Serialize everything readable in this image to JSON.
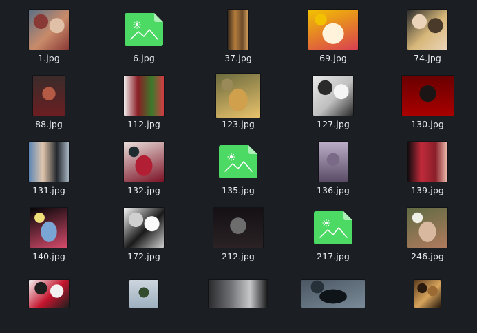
{
  "files": [
    {
      "name": "1.jpg",
      "kind": "photo",
      "selected": true,
      "colors": [
        "#5a6f86",
        "#c98b6a",
        "#8a3a36",
        "#e0c1a8"
      ]
    },
    {
      "name": "6.jpg",
      "kind": "image-icon",
      "colors": [
        "#4cd964",
        "#3fbf55"
      ]
    },
    {
      "name": "37.jpg",
      "kind": "photo",
      "colors": [
        "#3a2a1c",
        "#b57d3c",
        "#6b4a2a",
        "#d9a35d"
      ]
    },
    {
      "name": "69.jpg",
      "kind": "photo",
      "colors": [
        "#f2c200",
        "#fff3dc",
        "#d94050",
        "#f2c200"
      ]
    },
    {
      "name": "74.jpg",
      "kind": "photo",
      "colors": [
        "#2b2b2b",
        "#d8b87a",
        "#ead3b9",
        "#4a3a2a"
      ]
    },
    {
      "name": "88.jpg",
      "kind": "photo",
      "colors": [
        "#3a2c2a",
        "#b55a45",
        "#e5c6ad",
        "#6a1e22"
      ]
    },
    {
      "name": "112.jpg",
      "kind": "photo",
      "colors": [
        "#f1eeee",
        "#8a1d24",
        "#3b7a2b",
        "#d43a44"
      ]
    },
    {
      "name": "123.jpg",
      "kind": "photo",
      "colors": [
        "#6b6a3d",
        "#d1a04d",
        "#e8c26c",
        "#9a8a5a"
      ]
    },
    {
      "name": "127.jpg",
      "kind": "photo",
      "colors": [
        "#e9e9e9",
        "#bfbfbf",
        "#2a2a2a",
        "#f5f5f5"
      ]
    },
    {
      "name": "130.jpg",
      "kind": "photo",
      "colors": [
        "#6a0000",
        "#1b1515",
        "#2e2323",
        "#a80000"
      ]
    },
    {
      "name": "131.jpg",
      "kind": "photo",
      "colors": [
        "#5d86b5",
        "#e1c7ad",
        "#24282e",
        "#a7b6c3"
      ]
    },
    {
      "name": "132.jpg",
      "kind": "photo",
      "colors": [
        "#e9e0dc",
        "#b21f35",
        "#7c1326",
        "#1f2b2f"
      ]
    },
    {
      "name": "135.jpg",
      "kind": "image-icon",
      "colors": [
        "#4cd964",
        "#3fbf55"
      ]
    },
    {
      "name": "136.jpg",
      "kind": "photo",
      "colors": [
        "#bcaec9",
        "#7a6a88",
        "#efe7f0",
        "#5b4c66"
      ]
    },
    {
      "name": "139.jpg",
      "kind": "photo",
      "colors": [
        "#0e0c0e",
        "#c02a3a",
        "#8a1f2a",
        "#f0c0b0"
      ]
    },
    {
      "name": "140.jpg",
      "kind": "photo",
      "colors": [
        "#040607",
        "#7aa6d6",
        "#d64b6b",
        "#f0e07a"
      ]
    },
    {
      "name": "172.jpg",
      "kind": "photo",
      "colors": [
        "#f7f7f7",
        "#1a1a1a",
        "#d0d0d0",
        "#fafafa"
      ]
    },
    {
      "name": "212.jpg",
      "kind": "photo",
      "colors": [
        "#141014",
        "#6d6d6d",
        "#d6d6d6",
        "#2a2225"
      ]
    },
    {
      "name": "217.jpg",
      "kind": "image-icon",
      "colors": [
        "#4cd964",
        "#3fbf55"
      ]
    },
    {
      "name": "246.jpg",
      "kind": "photo",
      "colors": [
        "#5f6b43",
        "#d9b8a0",
        "#b07b5e",
        "#eef0e8"
      ]
    },
    {
      "name": "",
      "kind": "photo",
      "colors": [
        "#f2f2f2",
        "#c5152e",
        "#1e1e1e",
        "#f2f2f2"
      ]
    },
    {
      "name": "",
      "kind": "photo",
      "colors": [
        "#cdd5de",
        "#334c2d",
        "#0f1412",
        "#9fb0bf"
      ]
    },
    {
      "name": "",
      "kind": "photo",
      "colors": [
        "#2a2b2d",
        "#6a6b6f",
        "#c5c6c8",
        "#151617"
      ]
    },
    {
      "name": "",
      "kind": "photo",
      "colors": [
        "#4a5662",
        "#0f1418",
        "#7a8a98",
        "#263038"
      ]
    },
    {
      "name": "",
      "kind": "photo",
      "colors": [
        "#5b3b1e",
        "#d7a45c",
        "#2a1a0e",
        "#9b6a33"
      ]
    }
  ],
  "theme": {
    "background": "#1b1e23",
    "text": "#e8eaed",
    "selection_accent": "#3daee9",
    "icon_green": "#4cd964"
  }
}
